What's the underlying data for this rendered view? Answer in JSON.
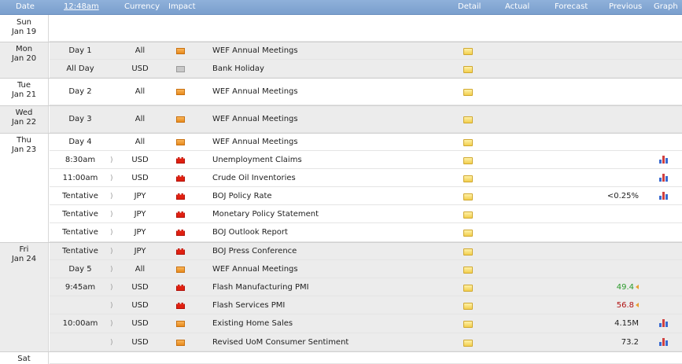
{
  "header": {
    "date": "Date",
    "time": "12:48am",
    "currency": "Currency",
    "impact": "Impact",
    "detail": "Detail",
    "actual": "Actual",
    "forecast": "Forecast",
    "previous": "Previous",
    "graph": "Graph"
  },
  "days": [
    {
      "dow": "Sun",
      "date": "Jan 19"
    },
    {
      "dow": "Mon",
      "date": "Jan 20"
    },
    {
      "dow": "Tue",
      "date": "Jan 21"
    },
    {
      "dow": "Wed",
      "date": "Jan 22"
    },
    {
      "dow": "Thu",
      "date": "Jan 23"
    },
    {
      "dow": "Fri",
      "date": "Jan 24"
    },
    {
      "dow": "Sat",
      "date": ""
    }
  ],
  "events": [
    {
      "time": "Day 1",
      "currency": "All",
      "impact": "medium",
      "event": "WEF Annual Meetings",
      "actual": "",
      "previous": "",
      "graph": false,
      "tentative": false
    },
    {
      "time": "All Day",
      "currency": "USD",
      "impact": "holiday",
      "event": "Bank Holiday",
      "actual": "",
      "previous": "",
      "graph": false,
      "tentative": false
    },
    {
      "time": "Day 2",
      "currency": "All",
      "impact": "medium",
      "event": "WEF Annual Meetings",
      "actual": "",
      "previous": "",
      "graph": false,
      "tentative": false
    },
    {
      "time": "Day 3",
      "currency": "All",
      "impact": "medium",
      "event": "WEF Annual Meetings",
      "actual": "",
      "previous": "",
      "graph": false,
      "tentative": false
    },
    {
      "time": "Day 4",
      "currency": "All",
      "impact": "medium",
      "event": "WEF Annual Meetings",
      "actual": "",
      "previous": "",
      "graph": false,
      "tentative": false
    },
    {
      "time": "8:30am",
      "currency": "USD",
      "impact": "high",
      "event": "Unemployment Claims",
      "actual": "",
      "previous": "",
      "graph": true,
      "tentative": true
    },
    {
      "time": "11:00am",
      "currency": "USD",
      "impact": "high",
      "event": "Crude Oil Inventories",
      "actual": "",
      "previous": "",
      "graph": true,
      "tentative": true
    },
    {
      "time": "Tentative",
      "currency": "JPY",
      "impact": "high",
      "event": "BOJ Policy Rate",
      "actual": "",
      "previous": "<0.25%",
      "graph": true,
      "tentative": true
    },
    {
      "time": "Tentative",
      "currency": "JPY",
      "impact": "high",
      "event": "Monetary Policy Statement",
      "actual": "",
      "previous": "",
      "graph": false,
      "tentative": true
    },
    {
      "time": "Tentative",
      "currency": "JPY",
      "impact": "high",
      "event": "BOJ Outlook Report",
      "actual": "",
      "previous": "",
      "graph": false,
      "tentative": true
    },
    {
      "time": "Tentative",
      "currency": "JPY",
      "impact": "high",
      "event": "BOJ Press Conference",
      "actual": "",
      "previous": "",
      "graph": false,
      "tentative": true
    },
    {
      "time": "Day 5",
      "currency": "All",
      "impact": "medium",
      "event": "WEF Annual Meetings",
      "actual": "",
      "previous": "",
      "graph": false,
      "tentative": true
    },
    {
      "time": "9:45am",
      "currency": "USD",
      "impact": "high",
      "event": "Flash Manufacturing PMI",
      "actual": "",
      "previous": "49.4",
      "previous_color": "#2a9a2a",
      "graph": false,
      "tentative": true
    },
    {
      "time": "",
      "currency": "USD",
      "impact": "high",
      "event": "Flash Services PMI",
      "actual": "",
      "previous": "56.8",
      "previous_color": "#b01010",
      "graph": false,
      "tentative": true
    },
    {
      "time": "10:00am",
      "currency": "USD",
      "impact": "medium",
      "event": "Existing Home Sales",
      "actual": "",
      "previous": "4.15M",
      "graph": true,
      "tentative": true
    },
    {
      "time": "",
      "currency": "USD",
      "impact": "medium",
      "event": "Revised UoM Consumer Sentiment",
      "actual": "",
      "previous": "73.2",
      "graph": true,
      "tentative": true
    }
  ],
  "timer_glyph": ")",
  "colors": {
    "header_bg": "#7a9fcd",
    "row_alt": "#ececec",
    "medium": "#e88a1c",
    "high": "#e02010",
    "holiday": "#c8c8c8"
  }
}
